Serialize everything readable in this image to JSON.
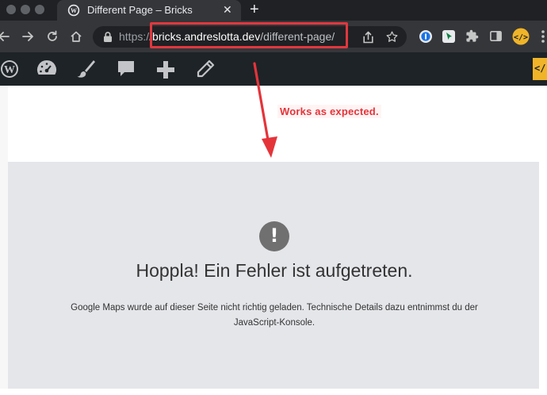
{
  "browser": {
    "tab_title": "Different Page – Bricks",
    "new_tab_icon": "plus-icon",
    "url_scheme": "https://",
    "url_host": "bricks.andreslotta.dev",
    "url_path": "/different-page/"
  },
  "wp_admin_bar": {
    "items": [
      "wordpress-logo-icon",
      "dashboard-icon",
      "customize-brush-icon",
      "comments-icon",
      "new-content-plus-icon",
      "edit-pencil-icon"
    ]
  },
  "annotation": {
    "text": "Works as expected.",
    "color": "#e4343a"
  },
  "error": {
    "icon": "exclamation-icon",
    "mark": "!",
    "title": "Hoppla! Ein Fehler ist aufgetreten.",
    "message": "Google Maps wurde auf dieser Seite nicht richtig geladen. Technische Details dazu entnimmst du der JavaScript-Konsole."
  },
  "colors": {
    "browser_chrome": "#35363a",
    "wp_admin_bar": "#1d2327",
    "error_panel_bg": "#e5e6ea",
    "url_highlight_border": "#e0383e",
    "bricks_accent": "#f0b429"
  }
}
